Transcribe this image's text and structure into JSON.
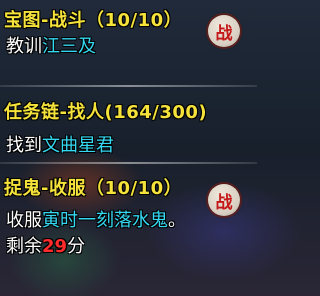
{
  "quests": [
    {
      "title": "宝图-战斗（10/10）",
      "action": "教训",
      "target": "江三及",
      "battle_label": "战"
    },
    {
      "title": "任务链-找人(164/300)",
      "action": "找到",
      "target": "文曲星君"
    },
    {
      "title": "捉鬼-收服（10/10）",
      "action": "收服",
      "target": "寅时一刻落水鬼",
      "target_suffix": "。",
      "remain_prefix": "剩余",
      "remain_value": "29",
      "remain_unit": "分",
      "battle_label": "战"
    }
  ],
  "colors": {
    "title": "#f5e23a",
    "text": "#ffffff",
    "highlight": "#35d8f2",
    "time": "#ff2a2a",
    "battle_icon": "#c51818"
  },
  "icons": {
    "battle": "battle-icon"
  }
}
